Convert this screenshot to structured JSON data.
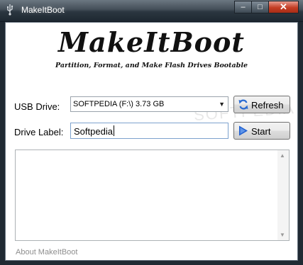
{
  "window": {
    "title": "MakeItBoot",
    "minimize_glyph": "–",
    "maximize_glyph": "□",
    "close_glyph": "✕",
    "icon": "usb-icon"
  },
  "header": {
    "logo_text": "MakeItBoot",
    "tagline": "Partition, Format, and Make Flash Drives Bootable"
  },
  "form": {
    "usb_label": "USB Drive:",
    "usb_selected": "SOFTPEDIA (F:\\) 3.73 GB",
    "drive_label": "Drive Label:",
    "drive_label_value": "Softpedia"
  },
  "buttons": {
    "refresh": "Refresh",
    "start": "Start",
    "refresh_icon": "refresh-icon",
    "start_icon": "play-icon"
  },
  "footer": {
    "about_link": "About MakeItBoot"
  },
  "watermark": "SOFTPEDIA",
  "colors": {
    "title_bar": "#2b3640",
    "close_button": "#c43d24",
    "refresh_icon": "#2a6bd1",
    "start_icon": "#1f5fd0",
    "focus_border": "#7da2ce"
  }
}
